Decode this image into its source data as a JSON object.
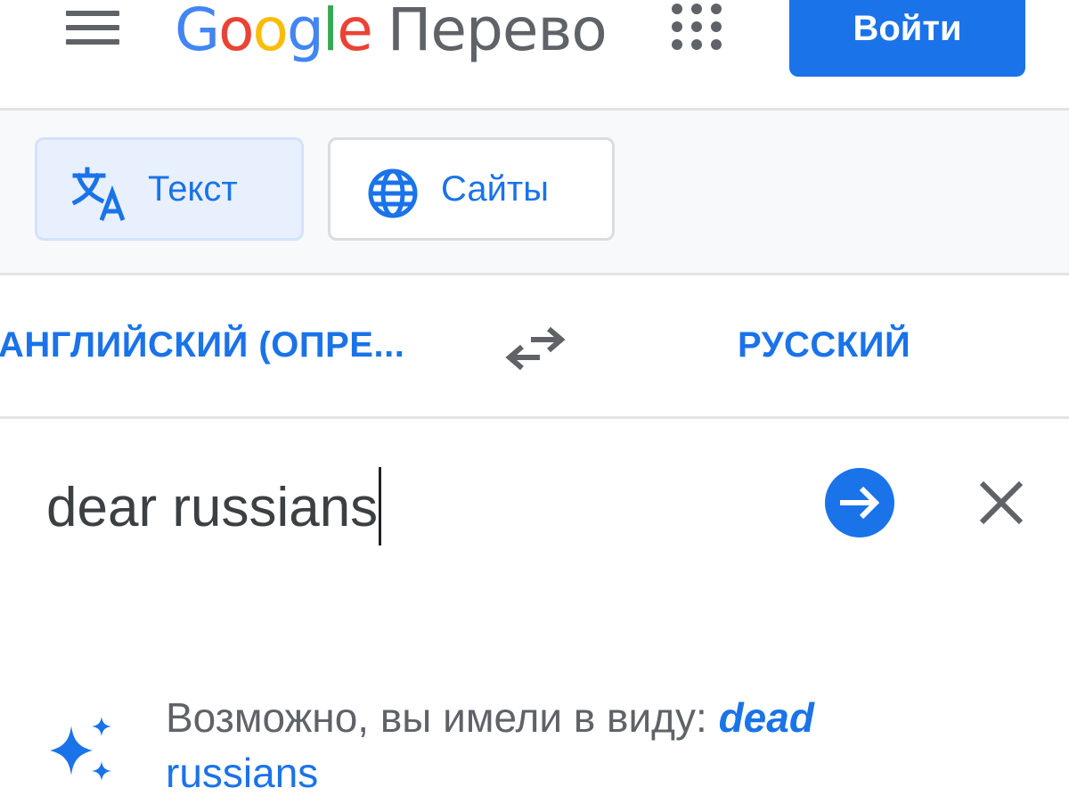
{
  "header": {
    "logo_parts": [
      "G",
      "o",
      "o",
      "g",
      "l",
      "e"
    ],
    "product_name": "Перево",
    "signin_label": "Войти"
  },
  "modes": [
    {
      "label": "Текст",
      "icon": "translate-icon",
      "active": true
    },
    {
      "label": "Сайты",
      "icon": "globe-icon",
      "active": false
    }
  ],
  "languages": {
    "source": "АНГЛИЙСКИЙ (ОПРЕ...",
    "target": "РУССКИЙ",
    "swap_icon": "swap-arrows-icon"
  },
  "input": {
    "text": "dear russians",
    "submit_icon": "arrow-right-circle-icon",
    "clear_icon": "close-icon"
  },
  "suggestion": {
    "icon": "sparkle-icon",
    "prefix": "Возможно, вы имели в виду: ",
    "emphasis": "dead",
    "rest": " russians"
  },
  "colors": {
    "accent": "#1a73e8",
    "text_primary": "#3c4043",
    "text_secondary": "#5f6368",
    "chip_active_bg": "#e8f0fe",
    "divider": "#e3e3e3"
  }
}
